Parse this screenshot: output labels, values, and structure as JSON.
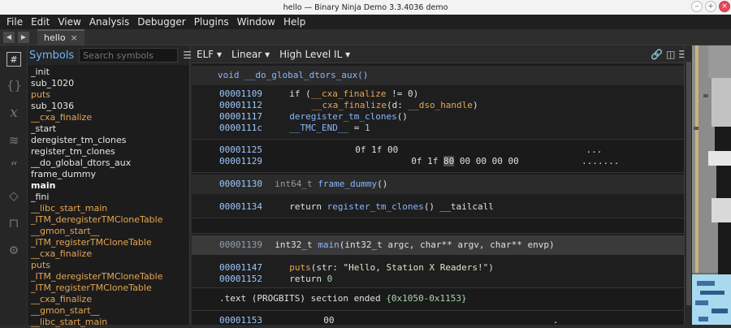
{
  "window": {
    "title": "hello — Binary Ninja Demo 3.3.4036 demo",
    "controls": [
      "–",
      "+",
      "×"
    ]
  },
  "menu": [
    "File",
    "Edit",
    "View",
    "Analysis",
    "Debugger",
    "Plugins",
    "Window",
    "Help"
  ],
  "tab": {
    "label": "hello",
    "close": "×"
  },
  "nav": {
    "back": "◀",
    "forward": "▶"
  },
  "rail_icons": [
    "binary-icon",
    "braces-icon",
    "variable-icon",
    "layers-icon",
    "quote-icon",
    "tag-icon",
    "flow-icon",
    "settings-icon"
  ],
  "symbols": {
    "title": "Symbols",
    "search_placeholder": "Search symbols",
    "menu": "☰",
    "items": [
      {
        "name": "_init",
        "kind": "normal"
      },
      {
        "name": "sub_1020",
        "kind": "normal"
      },
      {
        "name": "puts",
        "kind": "import"
      },
      {
        "name": "sub_1036",
        "kind": "normal"
      },
      {
        "name": "__cxa_finalize",
        "kind": "import"
      },
      {
        "name": "_start",
        "kind": "normal"
      },
      {
        "name": "deregister_tm_clones",
        "kind": "normal"
      },
      {
        "name": "register_tm_clones",
        "kind": "normal"
      },
      {
        "name": "__do_global_dtors_aux",
        "kind": "normal"
      },
      {
        "name": "frame_dummy",
        "kind": "normal"
      },
      {
        "name": "main",
        "kind": "bold"
      },
      {
        "name": "_fini",
        "kind": "normal"
      },
      {
        "name": "__libc_start_main",
        "kind": "import"
      },
      {
        "name": "_ITM_deregisterTMCloneTable",
        "kind": "import"
      },
      {
        "name": "__gmon_start__",
        "kind": "import"
      },
      {
        "name": "_ITM_registerTMCloneTable",
        "kind": "import"
      },
      {
        "name": "__cxa_finalize",
        "kind": "import"
      },
      {
        "name": "puts",
        "kind": "import"
      },
      {
        "name": "_ITM_deregisterTMCloneTable",
        "kind": "import"
      },
      {
        "name": "_ITM_registerTMCloneTable",
        "kind": "import"
      },
      {
        "name": "__cxa_finalize",
        "kind": "import"
      },
      {
        "name": "__gmon_start__",
        "kind": "import"
      },
      {
        "name": "__libc_start_main",
        "kind": "import"
      }
    ]
  },
  "toolbar": {
    "format": "ELF ▾",
    "view": "Linear ▾",
    "il": "High Level IL ▾",
    "right_icons": "🔗 ◫ ☰"
  },
  "code": {
    "dtors_header": "void __do_global_dtors_aux()",
    "l1109_addr": "00001109",
    "l1109_a": "if (",
    "l1109_b": "__cxa_finalize",
    "l1109_c": " != 0)",
    "l1112_addr": "00001112",
    "l1112_a": "__cxa_finalize",
    "l1112_b": "(d: ",
    "l1112_c": "__dso_handle",
    "l1112_d": ")",
    "l1117_addr": "00001117",
    "l1117_a": "deregister_tm_clones",
    "l1117_b": "()",
    "l111c_addr": "0000111c",
    "l111c_a": "__TMC_END__",
    "l111c_b": " = ",
    "l111c_c": "1",
    "hex1_addr": "00001125",
    "hex1_bytes": "0f 1f 00",
    "hex1_ascii": "...",
    "hex2_addr": "00001129",
    "hex2_pre": "0f 1f ",
    "hex2_hl": "80",
    "hex2_post": " 00 00 00 00",
    "hex2_ascii": ".......",
    "fd_addr": "00001130",
    "fd_type": "int64_t ",
    "fd_name": "frame_dummy",
    "fd_tail": "()",
    "fd1_addr": "00001134",
    "fd1_a": "return ",
    "fd1_b": "register_tm_clones",
    "fd1_c": "() __tailcall",
    "main_addr": "00001139",
    "main_a": "int32_t ",
    "main_b": "main",
    "main_c": "(int32_t argc, char** argv, char** envp)",
    "m1_addr": "00001147",
    "m1_a": "puts",
    "m1_b": "(str: ",
    "m1_c": "\"Hello, Station X Readers!\"",
    "m1_d": ")",
    "m2_addr": "00001152",
    "m2_a": "return ",
    "m2_b": "0",
    "sect_a": ".text (PROGBITS) section ended  ",
    "sect_b": "{0x1050-0x1153}",
    "last_addr": "00001153",
    "last_bytes": "00",
    "last_ascii": "."
  }
}
